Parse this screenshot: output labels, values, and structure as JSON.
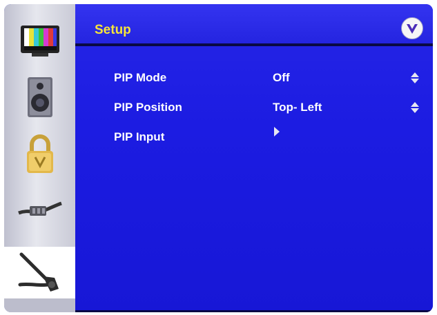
{
  "sidebar": {
    "items": [
      {
        "icon": "tv-picture-icon"
      },
      {
        "icon": "speaker-audio-icon"
      },
      {
        "icon": "padlock-icon"
      },
      {
        "icon": "cable-connector-icon"
      },
      {
        "icon": "wrench-tool-icon",
        "selected": true
      }
    ]
  },
  "header": {
    "title": "Setup",
    "logo_icon": "v-logo-icon"
  },
  "menu": {
    "rows": [
      {
        "label": "PIP Mode",
        "value": "Off",
        "control": "up-down-arrows-icon"
      },
      {
        "label": "PIP Position",
        "value": "Top- Left",
        "control": "up-down-arrows-icon"
      },
      {
        "label": "PIP Input",
        "value": "",
        "control": "right-arrow-icon"
      }
    ]
  },
  "colors": {
    "background": "#1c1ce2",
    "title": "#f5e43a",
    "text": "#ffffff",
    "sidebar": "#d6d7e1"
  }
}
